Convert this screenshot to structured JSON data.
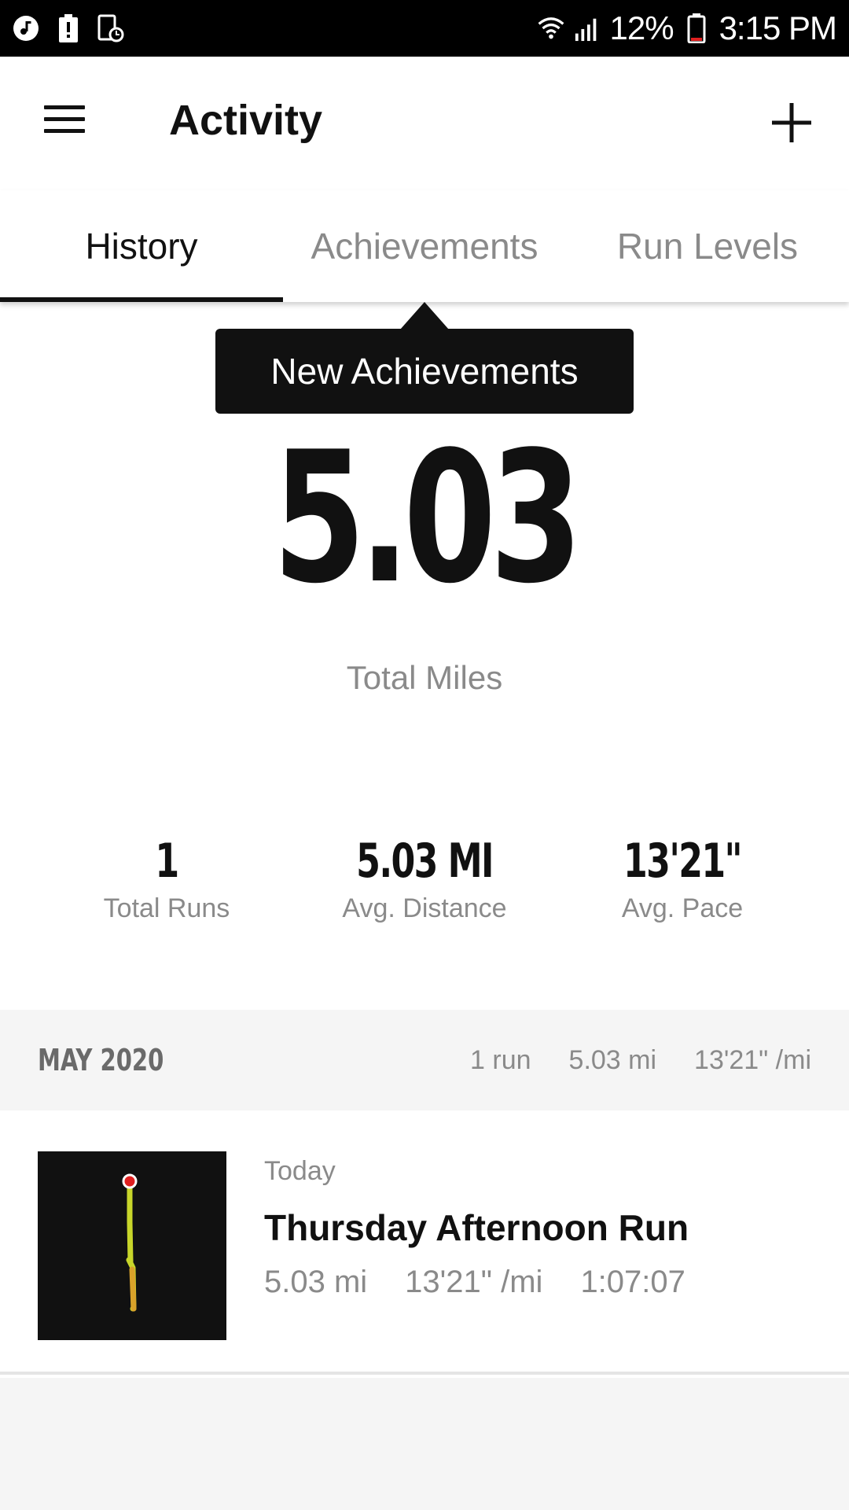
{
  "status_bar": {
    "battery": "12%",
    "time": "3:15 PM",
    "left_icons": [
      "music-icon",
      "battery-alert-icon",
      "screen-record-icon"
    ],
    "right_icons": [
      "wifi-icon",
      "signal-icon",
      "battery-icon"
    ]
  },
  "app_bar": {
    "title": "Activity",
    "menu_icon": "menu-icon",
    "add_icon": "plus-icon"
  },
  "tabs": [
    {
      "label": "History",
      "active": true
    },
    {
      "label": "Achievements",
      "active": false
    },
    {
      "label": "Run Levels",
      "active": false
    }
  ],
  "tooltip": {
    "text": "New Achievements"
  },
  "summary": {
    "total_miles": "5.03",
    "total_miles_label": "Total Miles",
    "stats": [
      {
        "value": "1",
        "label": "Total Runs"
      },
      {
        "value": "5.03 MI",
        "label": "Avg. Distance"
      },
      {
        "value": "13'21\"",
        "label": "Avg. Pace"
      }
    ]
  },
  "month": {
    "title": "MAY 2020",
    "runs": "1 run",
    "distance": "5.03 mi",
    "pace": "13'21\" /mi"
  },
  "run": {
    "date": "Today",
    "title": "Thursday Afternoon Run",
    "distance": "5.03 mi",
    "pace": "13'21\" /mi",
    "duration": "1:07:07"
  },
  "colors": {
    "status_bar": "#000000",
    "text_primary": "#111111",
    "text_secondary": "#8a8a8a",
    "section_bg": "#f5f5f5",
    "route_start": "#e02020",
    "route_line": "#c8d62a"
  }
}
